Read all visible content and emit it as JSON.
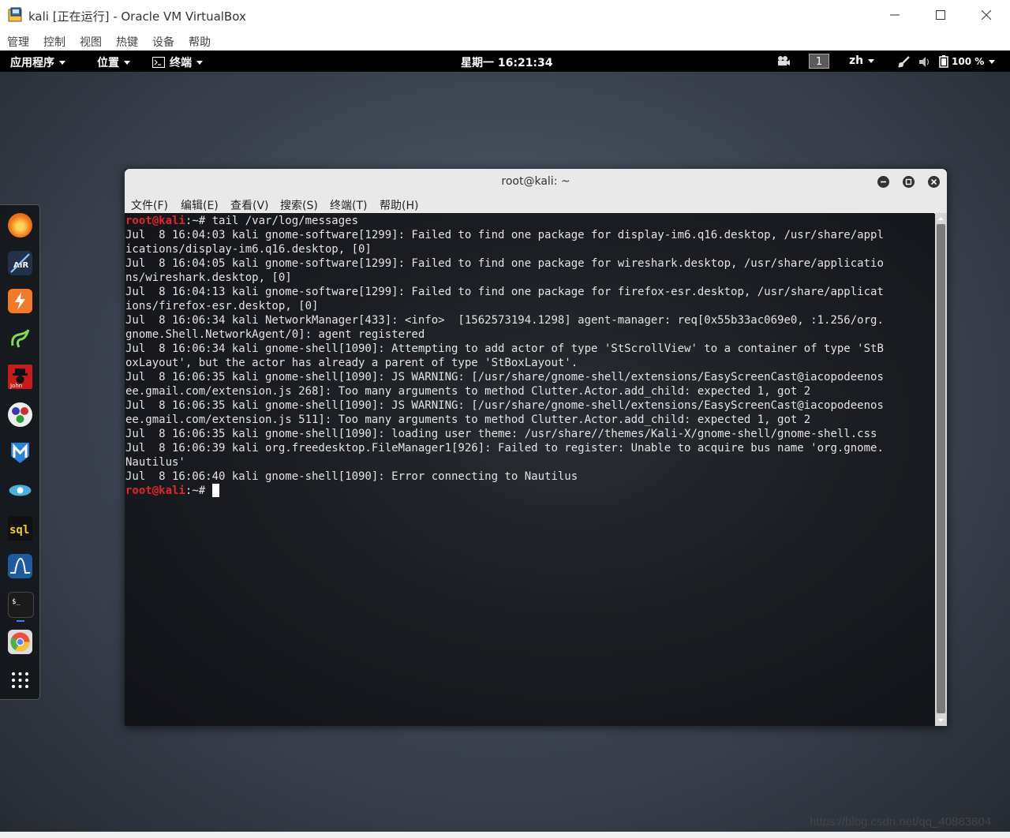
{
  "window": {
    "title": "kali [正在运行] - Oracle VM VirtualBox"
  },
  "vb_menu": [
    "管理",
    "控制",
    "视图",
    "热键",
    "设备",
    "帮助"
  ],
  "topbar": {
    "applications": "应用程序",
    "places": "位置",
    "terminal": "终端",
    "clock": "星期一 16:21:34",
    "workspace": "1",
    "language": "zh",
    "battery": "100 %"
  },
  "dock": {
    "icons": [
      "firefox-icon",
      "aircrack-icon",
      "burpsuite-icon",
      "maltego-icon",
      "john-icon",
      "armitage-icon",
      "metasploit-icon",
      "faraday-icon",
      "sqlmap-icon",
      "wireshark-icon",
      "terminal-icon",
      "chromium-icon",
      "show-apps-icon"
    ]
  },
  "terminal": {
    "title": "root@kali: ~",
    "menu": [
      "文件(F)",
      "编辑(E)",
      "查看(V)",
      "搜索(S)",
      "终端(T)",
      "帮助(H)"
    ],
    "prompt_user": "root@kali",
    "prompt_suffix": ":~#",
    "command": " tail /var/log/messages",
    "output": [
      "Jul  8 16:04:03 kali gnome-software[1299]: Failed to find one package for display-im6.q16.desktop, /usr/share/appl",
      "ications/display-im6.q16.desktop, [0]",
      "Jul  8 16:04:05 kali gnome-software[1299]: Failed to find one package for wireshark.desktop, /usr/share/applicatio",
      "ns/wireshark.desktop, [0]",
      "Jul  8 16:04:13 kali gnome-software[1299]: Failed to find one package for firefox-esr.desktop, /usr/share/applicat",
      "ions/firefox-esr.desktop, [0]",
      "Jul  8 16:06:34 kali NetworkManager[433]: <info>  [1562573194.1298] agent-manager: req[0x55b33ac069e0, :1.256/org.",
      "gnome.Shell.NetworkAgent/0]: agent registered",
      "Jul  8 16:06:34 kali gnome-shell[1090]: Attempting to add actor of type 'StScrollView' to a container of type 'StB",
      "oxLayout', but the actor has already a parent of type 'StBoxLayout'.",
      "Jul  8 16:06:35 kali gnome-shell[1090]: JS WARNING: [/usr/share/gnome-shell/extensions/EasyScreenCast@iacopodeenos",
      "ee.gmail.com/extension.js 268]: Too many arguments to method Clutter.Actor.add_child: expected 1, got 2",
      "Jul  8 16:06:35 kali gnome-shell[1090]: JS WARNING: [/usr/share/gnome-shell/extensions/EasyScreenCast@iacopodeenos",
      "ee.gmail.com/extension.js 511]: Too many arguments to method Clutter.Actor.add_child: expected 1, got 2",
      "Jul  8 16:06:35 kali gnome-shell[1090]: loading user theme: /usr/share//themes/Kali-X/gnome-shell/gnome-shell.css",
      "Jul  8 16:06:39 kali org.freedesktop.FileManager1[926]: Failed to register: Unable to acquire bus name 'org.gnome.",
      "Nautilus'",
      "Jul  8 16:06:40 kali gnome-shell[1090]: Error connecting to Nautilus"
    ]
  },
  "watermark": "https://blog.csdn.net/qq_40883804"
}
